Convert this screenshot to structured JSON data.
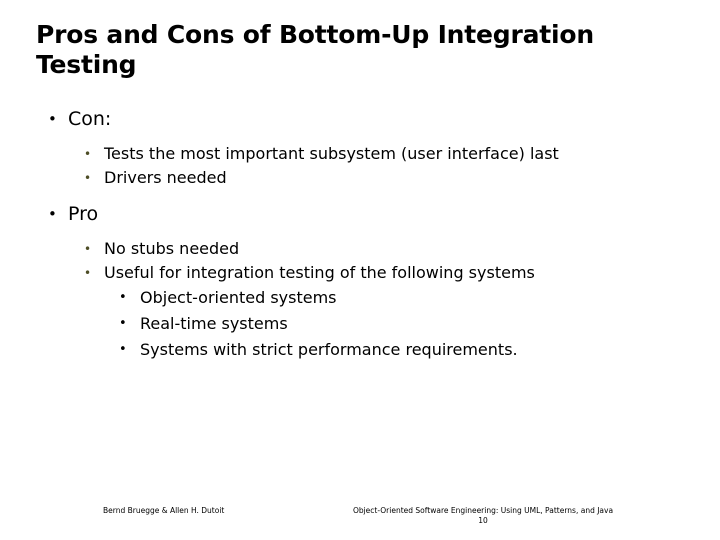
{
  "slide": {
    "title": "Pros and Cons of Bottom-Up Integration Testing",
    "page_number": "10",
    "background_color": "#ffffff",
    "text_color": "#000000",
    "level2_bullet_color": "#4d4d26",
    "bullet_glyph": "•",
    "content": [
      {
        "level": 1,
        "text": "Con:",
        "name": "bullet-con"
      },
      {
        "level": 2,
        "text": "Tests the most important subsystem (user interface) last",
        "name": "bullet-tests-most-important-subsystem"
      },
      {
        "level": 2,
        "text": "Drivers needed",
        "name": "bullet-drivers-needed"
      },
      {
        "level": 1,
        "text": "Pro",
        "name": "bullet-pro"
      },
      {
        "level": 2,
        "text": "No stubs needed",
        "name": "bullet-no-stubs-needed"
      },
      {
        "level": 2,
        "text": "Useful for integration testing of the following systems",
        "name": "bullet-useful-for-integration-testing"
      },
      {
        "level": 3,
        "text": "Object-oriented systems",
        "name": "bullet-object-oriented-systems"
      },
      {
        "level": 3,
        "text": "Real-time systems",
        "name": "bullet-real-time-systems"
      },
      {
        "level": 3,
        "text": "Systems with strict performance requirements.",
        "name": "bullet-systems-strict-performance"
      }
    ]
  },
  "footer": {
    "authors": "Bernd Bruegge & Allen H. Dutoit",
    "book_title": "Object-Oriented Software Engineering: Using UML, Patterns, and Java",
    "page_number": "10"
  }
}
